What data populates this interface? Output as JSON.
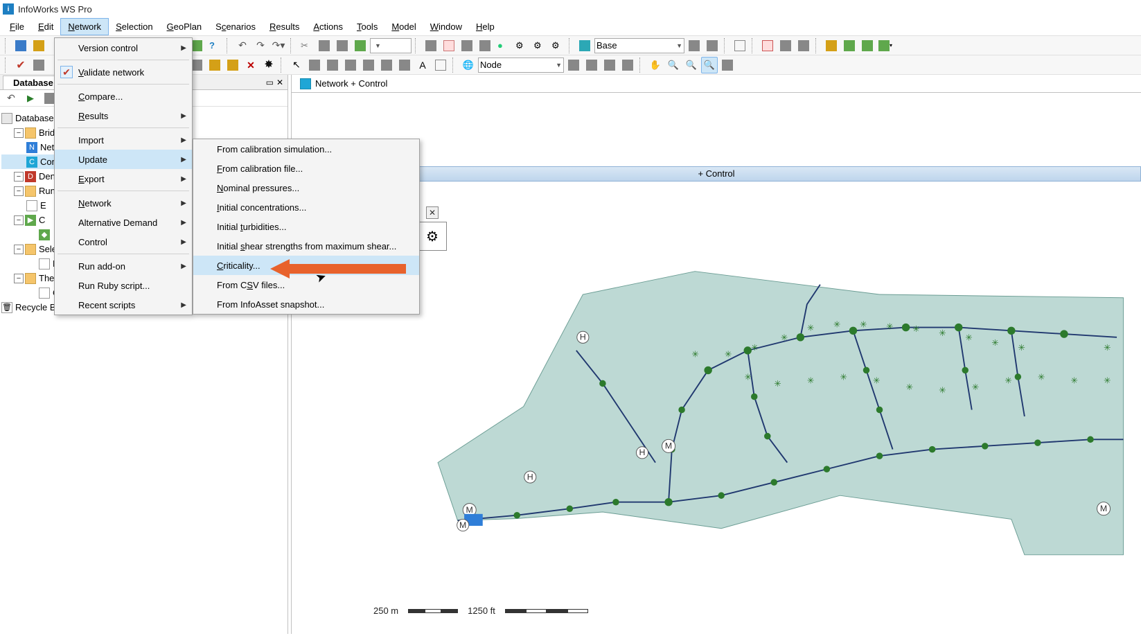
{
  "app": {
    "title": "InfoWorks WS Pro"
  },
  "menubar": {
    "items": [
      {
        "label": "File",
        "ul": "F"
      },
      {
        "label": "Edit",
        "ul": "E"
      },
      {
        "label": "Network",
        "ul": "N",
        "active": true
      },
      {
        "label": "Selection",
        "ul": "S"
      },
      {
        "label": "GeoPlan",
        "ul": "G"
      },
      {
        "label": "Scenarios",
        "ul": "c"
      },
      {
        "label": "Results",
        "ul": "R"
      },
      {
        "label": "Actions",
        "ul": "A"
      },
      {
        "label": "Tools",
        "ul": "T"
      },
      {
        "label": "Model",
        "ul": "M"
      },
      {
        "label": "Window",
        "ul": "W"
      },
      {
        "label": "Help",
        "ul": "H"
      }
    ]
  },
  "toolbar1": {
    "scenario_combo": "Base"
  },
  "toolbar2": {
    "node_combo": "Node"
  },
  "network_menu": {
    "items": [
      {
        "label": "Version control",
        "arrow": true
      },
      {
        "label": "Validate network",
        "check": true,
        "ul": "V"
      },
      {
        "label": "Compare...",
        "ul": "C"
      },
      {
        "label": "Results",
        "arrow": true,
        "ul": "R"
      },
      {
        "label": "Import",
        "arrow": true
      },
      {
        "label": "Update",
        "arrow": true,
        "active": true
      },
      {
        "label": "Export",
        "arrow": true,
        "ul": "E"
      },
      {
        "label": "Network",
        "arrow": true,
        "ul": "N"
      },
      {
        "label": "Alternative Demand",
        "arrow": true
      },
      {
        "label": "Control",
        "arrow": true
      },
      {
        "label": "Run add-on",
        "arrow": true
      },
      {
        "label": "Run Ruby script..."
      },
      {
        "label": "Recent scripts",
        "arrow": true
      }
    ]
  },
  "update_submenu": {
    "items": [
      {
        "label": "From calibration simulation..."
      },
      {
        "label": "From calibration file...",
        "ul": "F"
      },
      {
        "label": "Nominal pressures...",
        "ul": "N"
      },
      {
        "label": "Initial concentrations...",
        "ul": "I"
      },
      {
        "label": "Initial turbidities...",
        "ul": "t"
      },
      {
        "label": "Initial shear strengths from maximum shear...",
        "ul": "s"
      },
      {
        "label": "Criticality...",
        "ul": "C",
        "highlight": true
      },
      {
        "label": "From CSV files...",
        "ul": "S"
      },
      {
        "label": "From InfoAsset snapshot..."
      }
    ]
  },
  "left_panel": {
    "tab": "Database",
    "tree": {
      "root": "Database",
      "bridge": "Bridge",
      "net": "Net",
      "con": "Con",
      "den": "Den",
      "run": "Run",
      "runE": "E",
      "runC": "C",
      "sel_group": "Selection List Group",
      "pipes": "Pipes",
      "theme_group": "Theme Group",
      "criticality": "Criticality",
      "recycle": "Recycle Bin"
    }
  },
  "main_view": {
    "tab_label": "Network + Control",
    "geoplan_title": "+ Control",
    "scale_m": "250 m",
    "scale_ft": "1250 ft"
  },
  "colors": {
    "highlight": "#cde6f7",
    "callout": "#e8622c",
    "water_fill": "#bdd9d4",
    "node_green": "#2c7a2c",
    "pipe_blue": "#20386f"
  }
}
